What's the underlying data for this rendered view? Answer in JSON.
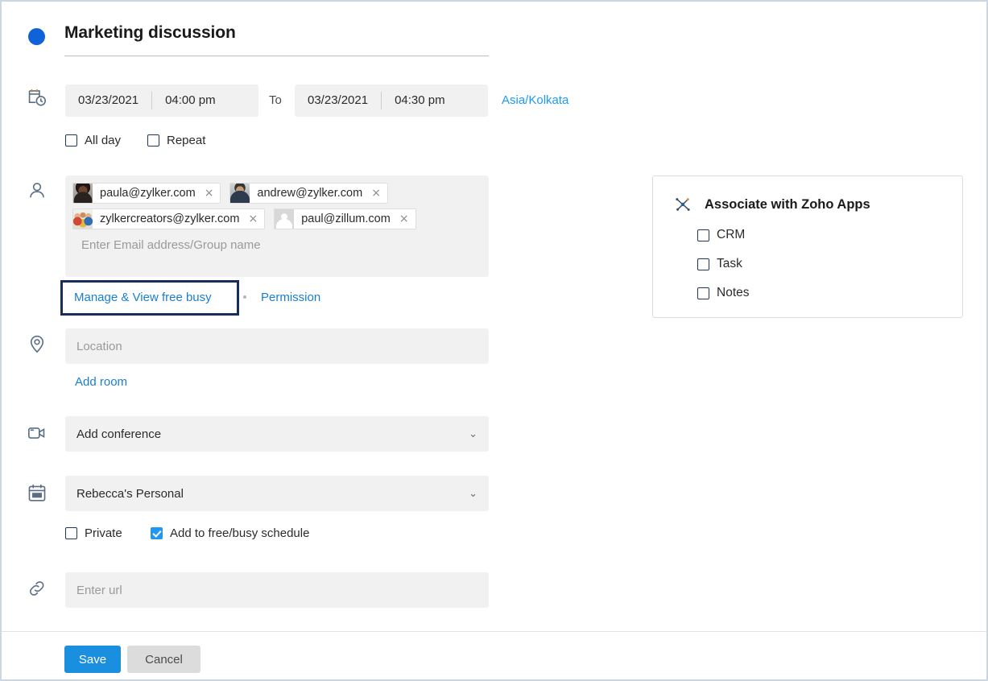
{
  "event": {
    "dot_color": "#0f62d8",
    "title": "Marketing discussion"
  },
  "datetime": {
    "start_date": "03/23/2021",
    "start_time": "04:00 pm",
    "to_label": "To",
    "end_date": "03/23/2021",
    "end_time": "04:30 pm",
    "timezone": "Asia/Kolkata",
    "options": [
      {
        "label": "All day",
        "checked": false
      },
      {
        "label": "Repeat",
        "checked": false
      }
    ]
  },
  "attendees": {
    "chips": [
      {
        "email": "paula@zylker.com",
        "avatar": "av-paula",
        "remove": "×"
      },
      {
        "email": "andrew@zylker.com",
        "avatar": "av-andrew",
        "remove": "×"
      },
      {
        "email": "zylkercreators@zylker.com",
        "avatar": "av-group",
        "remove": "×"
      },
      {
        "email": "paul@zillum.com",
        "avatar": "av-default",
        "remove": "×"
      }
    ],
    "placeholder": "Enter Email address/Group name",
    "manage_link": "Manage & View free busy",
    "permission_link": "Permission",
    "highlight_color": "#172d5c"
  },
  "location": {
    "placeholder": "Location",
    "add_room_link": "Add room"
  },
  "conference": {
    "value": "Add conference",
    "chevron": "⌄"
  },
  "calendar": {
    "value": "Rebecca's Personal",
    "chevron": "⌄",
    "options": [
      {
        "label": "Private",
        "checked": false
      },
      {
        "label": "Add to free/busy schedule",
        "checked": true
      }
    ],
    "accent": "#2196f3"
  },
  "url": {
    "placeholder": "Enter url"
  },
  "zoho_apps": {
    "title": "Associate with Zoho Apps",
    "items": [
      {
        "label": "CRM",
        "checked": false
      },
      {
        "label": "Task",
        "checked": false
      },
      {
        "label": "Notes",
        "checked": false
      }
    ]
  },
  "footer": {
    "save_label": "Save",
    "cancel_label": "Cancel",
    "save_color": "#1a8fe0"
  }
}
